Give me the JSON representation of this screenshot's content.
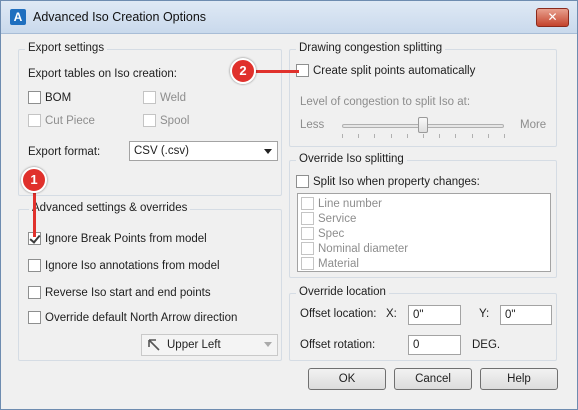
{
  "window": {
    "title": "Advanced Iso Creation Options",
    "close_label": "✕",
    "app_icon_letter": "A"
  },
  "export": {
    "legend": "Export settings",
    "tables_label": "Export tables on Iso creation:",
    "bom": "BOM",
    "weld": "Weld",
    "cut_piece": "Cut Piece",
    "spool": "Spool",
    "format_label": "Export format:",
    "format_value": "CSV (.csv)"
  },
  "advanced": {
    "legend": "Advanced settings & overrides",
    "ignore_break": "Ignore Break Points from model",
    "ignore_annotations": "Ignore Iso annotations from model",
    "reverse": "Reverse Iso start and end points",
    "override_north": "Override default North Arrow direction",
    "north_value": "Upper Left"
  },
  "congestion": {
    "legend": "Drawing congestion splitting",
    "create_split": "Create split points automatically",
    "level_label": "Level of congestion to split Iso at:",
    "less": "Less",
    "more": "More",
    "slider_level": 0.5
  },
  "override_split": {
    "legend": "Override Iso splitting",
    "split_label": "Split Iso when property changes:",
    "properties": [
      "Line number",
      "Service",
      "Spec",
      "Nominal diameter",
      "Material"
    ]
  },
  "location": {
    "legend": "Override location",
    "offset_label": "Offset location:",
    "x_label": "X:",
    "x_value": "0\"",
    "y_label": "Y:",
    "y_value": "0\"",
    "rotation_label": "Offset rotation:",
    "rotation_value": "0",
    "deg_label": "DEG."
  },
  "buttons": {
    "ok": "OK",
    "cancel": "Cancel",
    "help": "Help"
  },
  "callouts": {
    "one": "1",
    "two": "2"
  },
  "colors": {
    "callout": "#e0312c",
    "title_gradient": "#dfe9f5",
    "close": "#c4432c"
  }
}
